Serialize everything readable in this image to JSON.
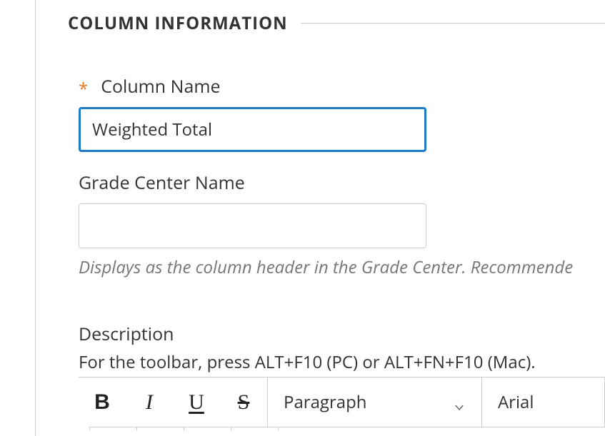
{
  "section": {
    "title": "COLUMN INFORMATION"
  },
  "fields": {
    "columnName": {
      "label": "Column Name",
      "value": "Weighted Total",
      "required": true
    },
    "gradeCenterName": {
      "label": "Grade Center Name",
      "value": "",
      "help": "Displays as the column header in the Grade Center. Recommende"
    },
    "description": {
      "label": "Description",
      "hint": "For the toolbar, press ALT+F10 (PC) or ALT+FN+F10 (Mac)."
    }
  },
  "editor": {
    "bold": "B",
    "italic": "I",
    "underline": "U",
    "strike": "S",
    "formatDropdown": "Paragraph",
    "fontDropdown": "Arial"
  },
  "requiredGlyph": "*"
}
